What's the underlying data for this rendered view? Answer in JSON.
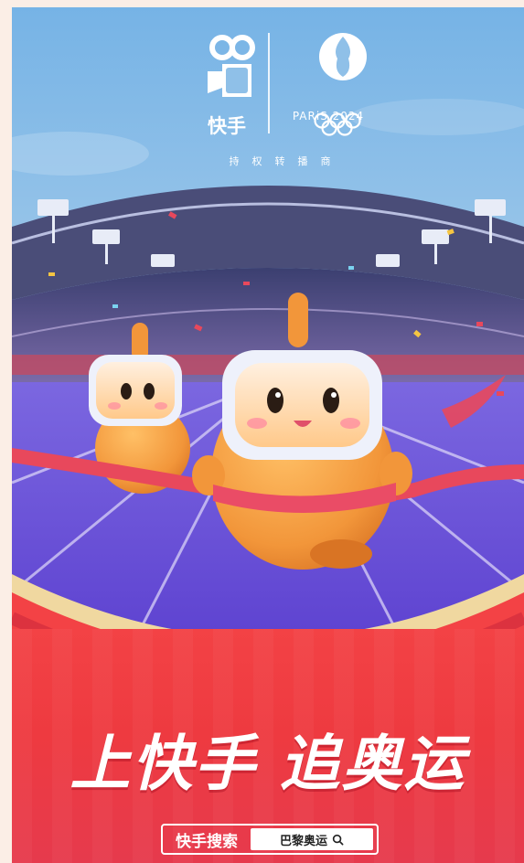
{
  "logo": {
    "brand_name": "快手",
    "partner_text": "持权转播商",
    "olympic_text": "PARiS 2024"
  },
  "slogan": "上快手 追奥运",
  "search": {
    "label": "快手搜索",
    "query": "巴黎奥运"
  },
  "colors": {
    "sky": "#8fc0e8",
    "track": "#6a52d6",
    "banner": "#f03c42",
    "mascot": "#f39a3a",
    "ribbon": "#e8485c"
  },
  "icons": [
    "kuaishou-logo-icon",
    "paris-2024-flame-icon",
    "olympic-rings-icon",
    "search-icon"
  ]
}
